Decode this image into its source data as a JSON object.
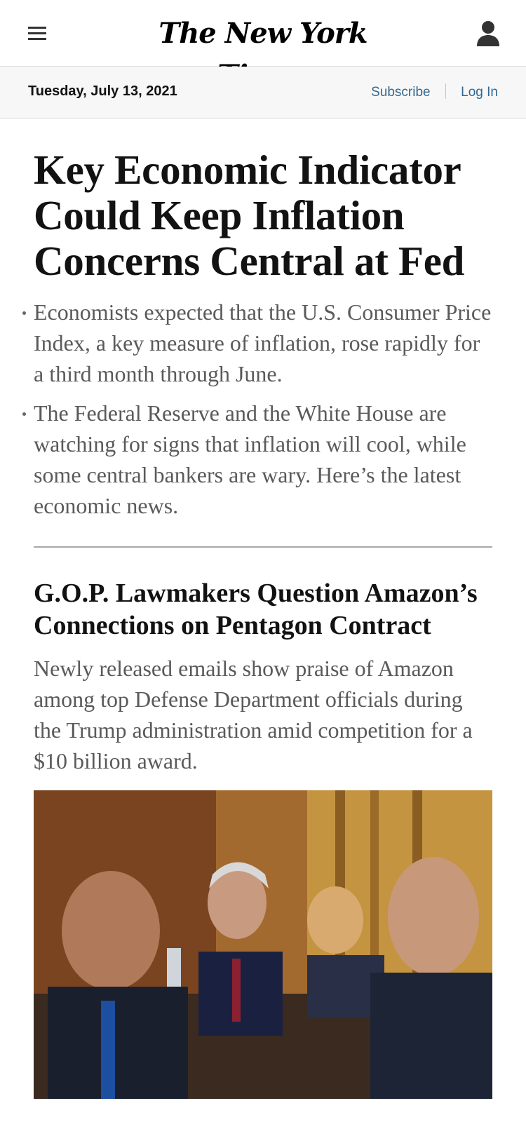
{
  "header": {
    "logo_text": "The New York Times",
    "menu_icon": "hamburger-menu-icon",
    "account_icon": "account-icon"
  },
  "datebar": {
    "date": "Tuesday, July 13, 2021",
    "subscribe": "Subscribe",
    "login": "Log In"
  },
  "lead_story": {
    "headline": "Key Economic Indicator Could Keep Inflation Concerns Central at Fed",
    "bullets": [
      "Economists expected that the U.S. Consumer Price Index, a key measure of inflation, rose rapidly for a third month through June.",
      "The Federal Reserve and the White House are watching for signs that inflation will cool, while some central bankers are wary. Here’s the latest economic news."
    ]
  },
  "second_story": {
    "headline": "G.O.P. Lawmakers Question Amazon’s Connections on Pentagon Contract",
    "summary": "Newly released emails show praise of Amazon among top Defense Department officials during the Trump administration amid competition for a $10 billion award."
  },
  "colors": {
    "link": "#326891",
    "summary_text": "#5a5a5a",
    "headline_text": "#121212"
  }
}
